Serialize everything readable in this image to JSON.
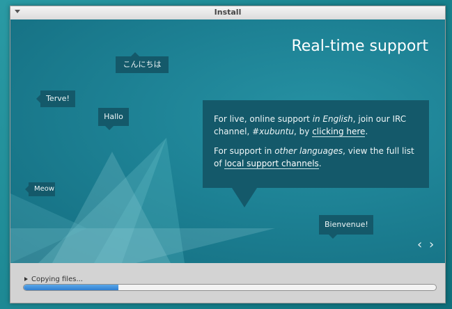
{
  "window": {
    "title": "Install"
  },
  "slide": {
    "title": "Real-time support",
    "bubbles": {
      "konnichiwa": "こんにちは",
      "terve": "Terve!",
      "hallo": "Hallo",
      "meow": "Meow",
      "bienvenue": "Bienvenue!"
    },
    "info": {
      "p1_a": "For live, online support ",
      "p1_b": "in English",
      "p1_c": ", join our IRC channel, ",
      "p1_d": "#xubuntu",
      "p1_e": ", by ",
      "p1_link": "clicking here",
      "p1_f": ".",
      "p2_a": "For support in ",
      "p2_b": "other languages",
      "p2_c": ", view the full list of ",
      "p2_link": "local support channels",
      "p2_d": "."
    },
    "prev_glyph": "‹",
    "next_glyph": "›"
  },
  "status": {
    "label": "Copying files...",
    "progress": 0.23
  },
  "colors": {
    "slide_bg": "#1b7e90",
    "bubble_bg": "#14596a",
    "progress_fill": "#3a8ddb"
  }
}
